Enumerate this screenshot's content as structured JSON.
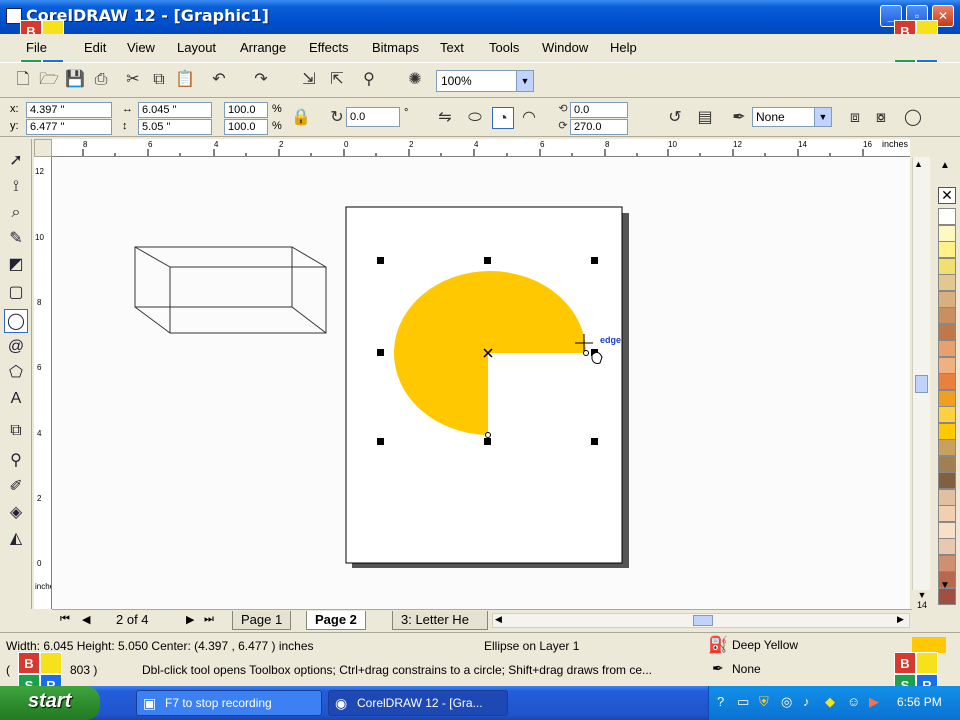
{
  "window": {
    "title": "CorelDRAW 12 - [Graphic1]",
    "controls": {
      "minimize": "_",
      "restore": "▫",
      "close": "✕"
    }
  },
  "overlay_logo": {
    "b": "B",
    "s": "S",
    "r": "R"
  },
  "menu": [
    "File",
    "Edit",
    "View",
    "Layout",
    "Arrange",
    "Effects",
    "Bitmaps",
    "Text",
    "Tools",
    "Window",
    "Help"
  ],
  "toolbar": {
    "zoom": "100%"
  },
  "propbar": {
    "x_label": "x:",
    "x": "4.397 \"",
    "y_label": "y:",
    "y": "6.477 \"",
    "width": "6.045 \"",
    "height": "5.05 \"",
    "scale_w": "100.0",
    "scale_h": "100.0",
    "pct": "%",
    "rotation": "0.0",
    "degree": "°",
    "start_angle": "0.0",
    "end_angle": "270.0",
    "outline": "None"
  },
  "rulers": {
    "unit": "inches",
    "h_ticks": [
      "8",
      "6",
      "4",
      "2",
      "0",
      "2",
      "4",
      "6",
      "8",
      "10",
      "12",
      "14",
      "16"
    ],
    "v_ticks": [
      "12",
      "10",
      "8",
      "6",
      "4",
      "2",
      "0"
    ],
    "v_unit": "inches"
  },
  "canvas": {
    "cursor_hint": "edge",
    "pie_fill": "#ffc800"
  },
  "pages": {
    "counter": "2 of 4",
    "tabs": [
      "Page 1",
      "Page 2",
      "3: Letter He"
    ],
    "active": 1
  },
  "status": {
    "dimensions": "Width: 6.045  Height: 5.050  Center: (4.397 , 6.477 )  inches",
    "object": "Ellipse on Layer 1",
    "fill_name": "Deep Yellow",
    "outline_name": "None",
    "hint": "Dbl-click tool opens Toolbox options; Ctrl+drag constrains to a circle; Shift+drag draws from ce...",
    "coords_prefix": "(",
    "coords_suffix": "803 )",
    "fill_color": "#ffc800"
  },
  "taskbar": {
    "start": "start",
    "tasks": [
      "F7 to stop recording",
      "CorelDRAW 12 - [Gra..."
    ],
    "clock": "6:56 PM"
  },
  "palette_colors": [
    "#ffffff",
    "#fff8c0",
    "#fff088",
    "#f0e070",
    "#e0c890",
    "#d8b080",
    "#c89060",
    "#c07848",
    "#e8a070",
    "#f0b080",
    "#e88040",
    "#f0a020",
    "#ffd040",
    "#ffc800",
    "#c8a060",
    "#a08050",
    "#806040",
    "#e0c0a0",
    "#f0d0b0",
    "#f8e0c8",
    "#e8c8b0",
    "#d09070",
    "#b86850",
    "#a05040"
  ]
}
